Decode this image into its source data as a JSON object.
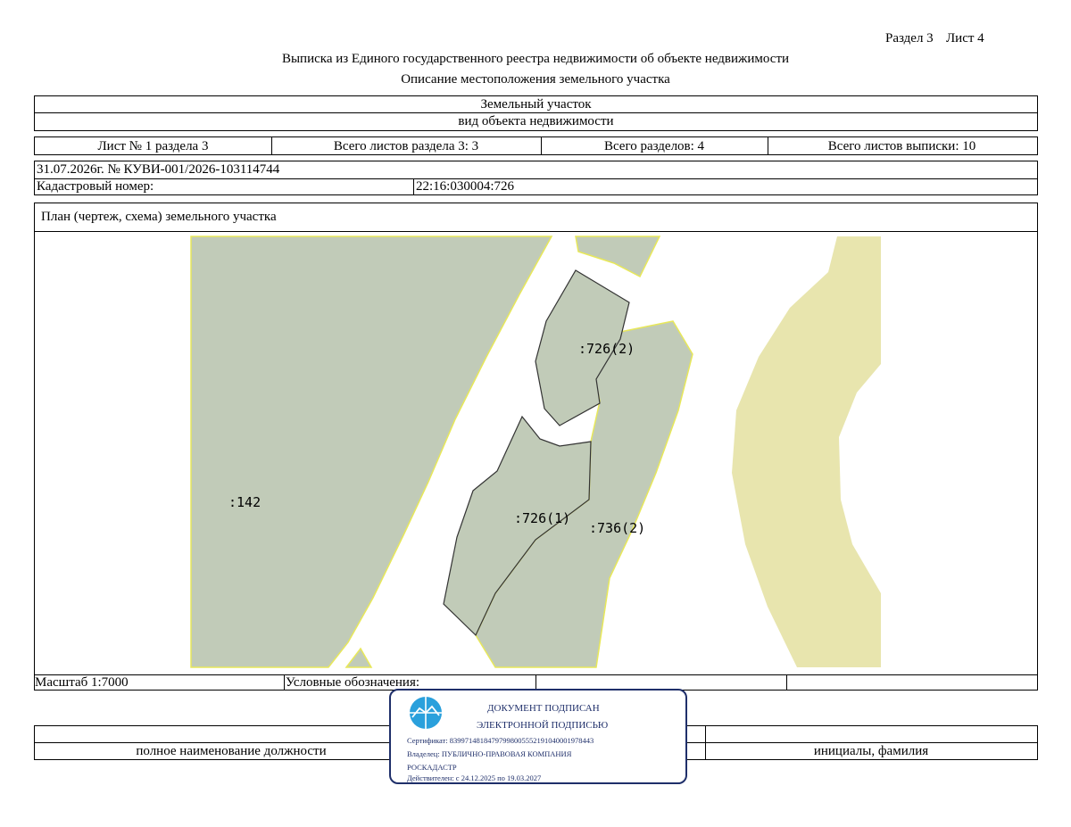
{
  "header": {
    "section_label": "Раздел 3",
    "sheet_label": "Лист 4",
    "title": "Выписка из Единого государственного реестра недвижимости об объекте недвижимости",
    "subtitle": "Описание местоположения земельного участка"
  },
  "object": {
    "type": "Земельный участок",
    "type_caption": "вид объекта недвижимости"
  },
  "sheet_info": {
    "sheet_of_section": "Лист № 1 раздела 3",
    "total_sheets_section": "Всего листов раздела 3: 3",
    "total_sections": "Всего разделов: 4",
    "total_sheets_extract": "Всего листов выписки: 10"
  },
  "record": {
    "date_number": "31.07.2026г. № КУВИ-001/2026-103114744",
    "cadastral_label": "Кадастровый номер:",
    "cadastral_value": "22:16:030004:726"
  },
  "plan": {
    "title": "План (чертеж, схема) земельного участка",
    "labels": {
      "parcel_142": ":142",
      "parcel_726_2": ":726(2)",
      "parcel_726_1": ":726(1)",
      "parcel_736_2": ":736(2)"
    },
    "colors": {
      "parcel_fill": "#c1cbb8",
      "water_fill": "#e8e5ae",
      "border_yellow": "#e8e85a"
    }
  },
  "footer": {
    "scale": "Масштаб 1:7000",
    "legend_label": "Условные обозначения:",
    "position_caption": "полное наименование должности",
    "name_caption": "инициалы, фамилия"
  },
  "stamp": {
    "line1": "ДОКУМЕНТ ПОДПИСАН",
    "line2": "ЭЛЕКТРОННОЙ ПОДПИСЬЮ",
    "certificate": "Сертификат: 83997148184797998005552191040001978443",
    "owner_line1": "Владелец: ПУБЛИЧНО-ПРАВОВАЯ КОМПАНИЯ",
    "owner_line2": "РОСКАДАСТР",
    "valid": "Действителен: с 24.12.2025 по 19.03.2027",
    "color": "#1f2f6a",
    "logo_color": "#2aa0dc"
  }
}
